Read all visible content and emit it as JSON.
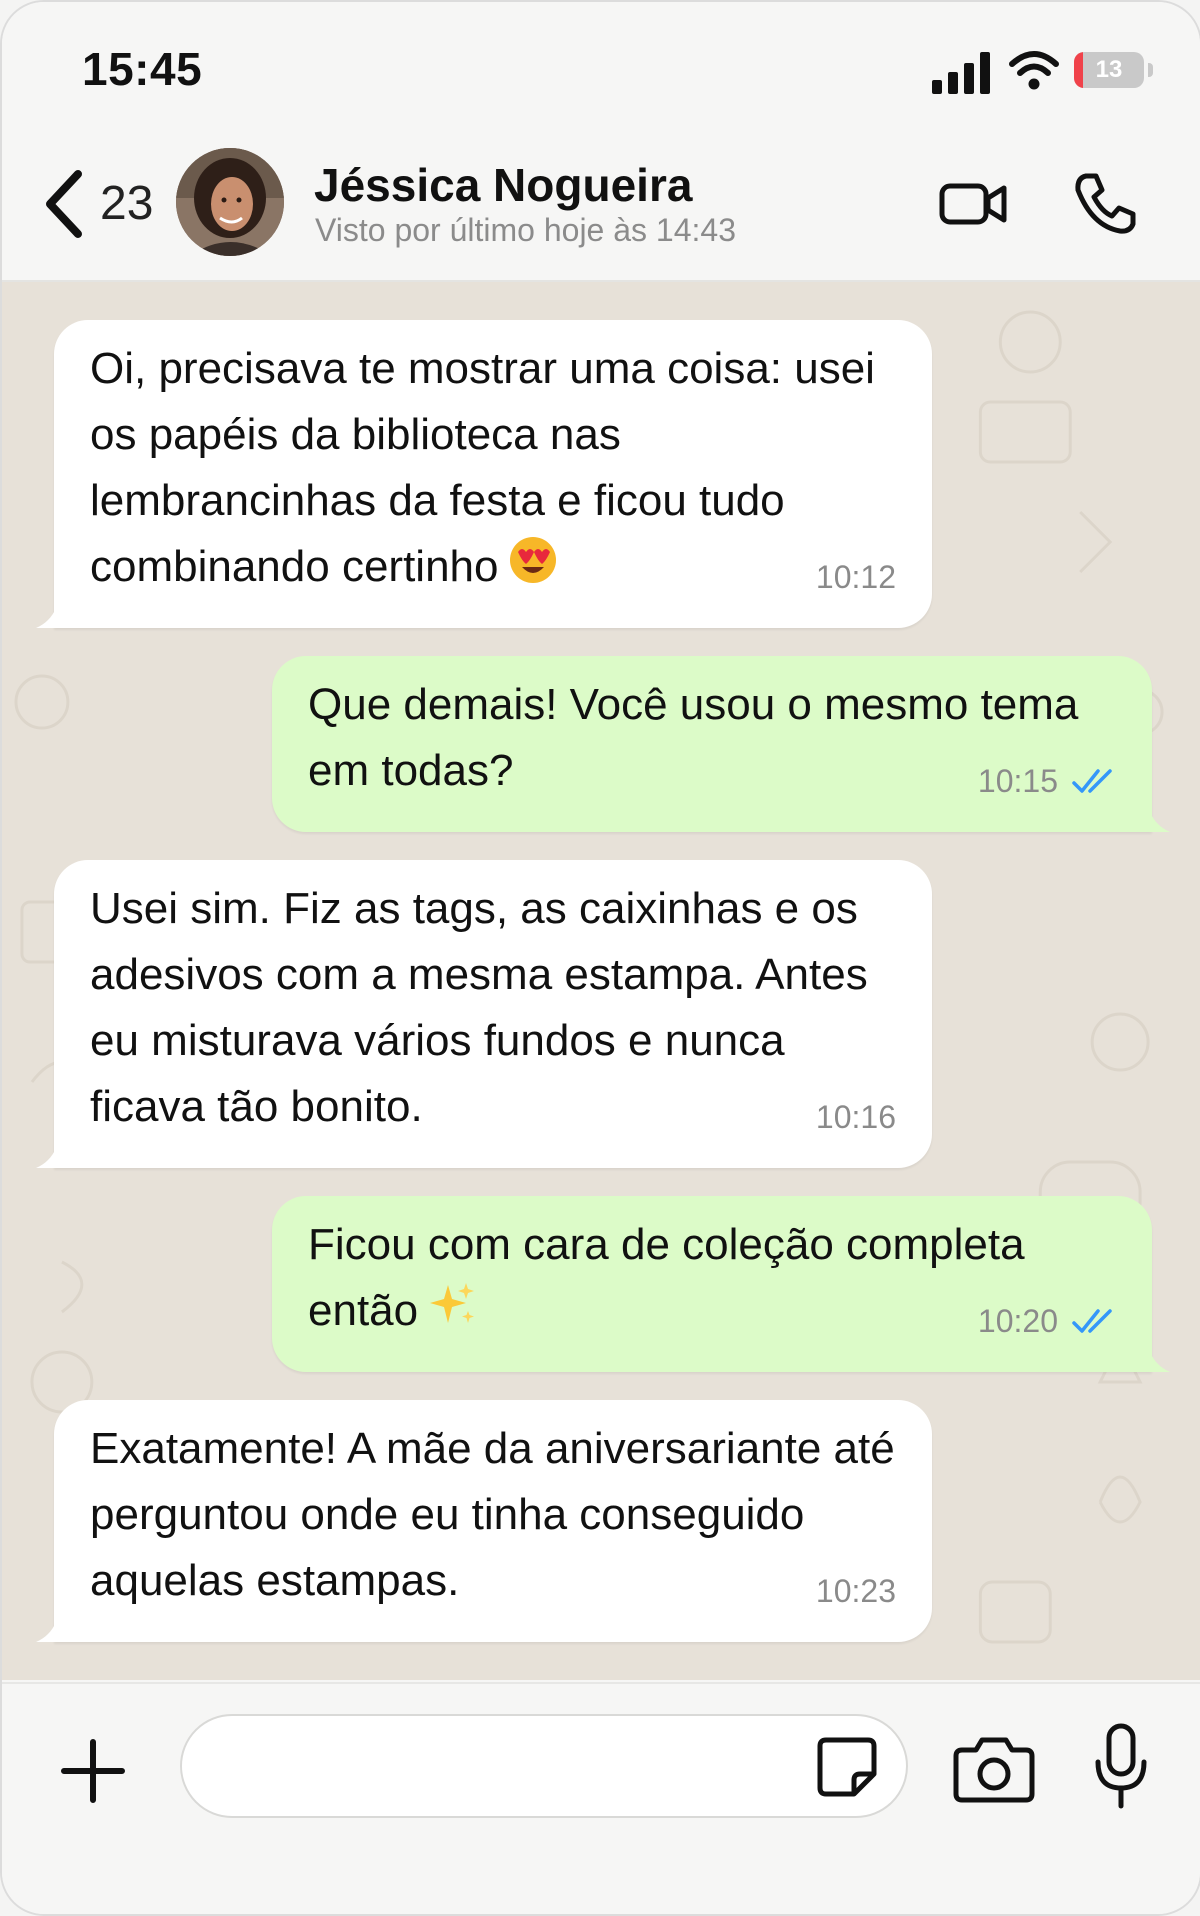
{
  "status_bar": {
    "time": "15:45",
    "battery": "13",
    "battery_level": 0.13
  },
  "header": {
    "back_count": "23",
    "contact_name": "Jéssica Nogueira",
    "last_seen": "Visto por último hoje às 14:43"
  },
  "messages": [
    {
      "direction": "in",
      "text": "Oi, precisava te mostrar uma coisa: usei os papéis da biblioteca nas lembrancinhas da festa e ficou tudo combinando certinho",
      "emoji": "heart-eyes-emoji",
      "time": "10:12"
    },
    {
      "direction": "out",
      "text": "Que demais! Você usou o mesmo tema em todas?",
      "time": "10:15",
      "read": true
    },
    {
      "direction": "in",
      "text": "Usei sim. Fiz as tags, as caixinhas e os adesivos com a mesma estampa. Antes eu misturava vários fundos e nunca ficava tão bonito.",
      "time": "10:16"
    },
    {
      "direction": "out",
      "text": "Ficou com cara de coleção completa então",
      "emoji": "sparkles-emoji",
      "time": "10:20",
      "read": true
    },
    {
      "direction": "in",
      "text": "Exatamente! A mãe da aniversariante até perguntou onde eu tinha conseguido aquelas estampas.",
      "time": "10:23"
    }
  ],
  "input": {
    "placeholder": ""
  },
  "colors": {
    "incoming": "#ffffff",
    "outgoing": "#dcfbc8",
    "chat_bg": "#e7e1d8",
    "read_ticks": "#3497f9"
  },
  "icons": [
    "back-chevron-icon",
    "video-call-icon",
    "phone-call-icon",
    "plus-icon",
    "sticker-icon",
    "camera-icon",
    "microphone-icon"
  ]
}
